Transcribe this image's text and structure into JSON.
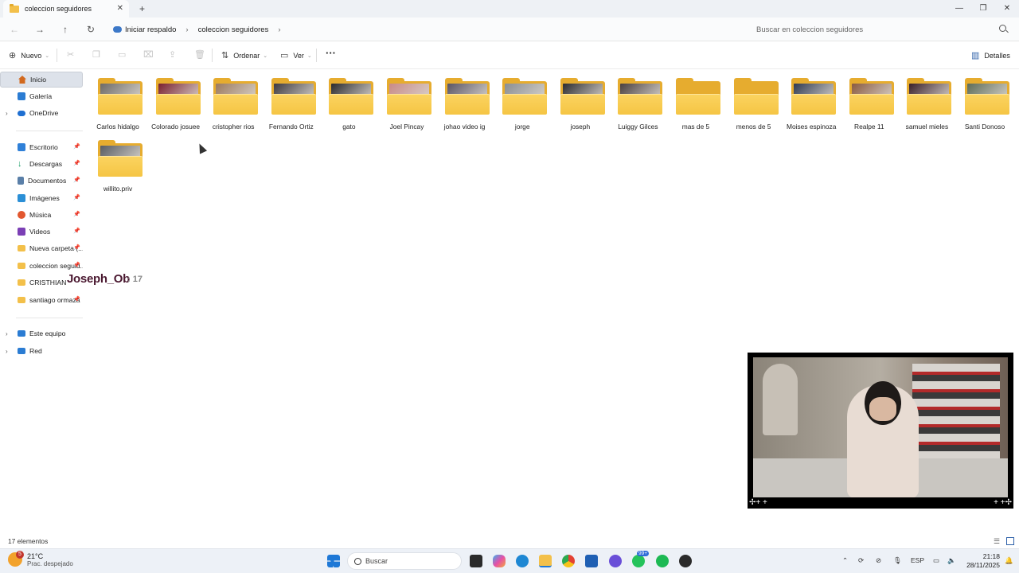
{
  "window": {
    "tab_title": "coleccion seguidores",
    "new_tab": "+",
    "minimize": "—",
    "maximize": "❐",
    "close": "✕"
  },
  "nav": {
    "back": "←",
    "forward": "→",
    "up": "↑",
    "refresh": "↻",
    "breadcrumb": [
      "Iniciar respaldo",
      "coleccion seguidores"
    ],
    "search_placeholder": "Buscar en coleccion seguidores"
  },
  "commandbar": {
    "new_label": "Nuevo",
    "sort_label": "Ordenar",
    "view_label": "Ver",
    "more": "···",
    "details_label": "Detalles"
  },
  "sidebar": {
    "items": [
      {
        "label": "Inicio",
        "icon": "home-icon",
        "color": "#d2691e"
      },
      {
        "label": "Galería",
        "icon": "gallery-icon",
        "color": "#2b7cd3"
      },
      {
        "label": "OneDrive",
        "icon": "cloud-icon",
        "color": "#1f6fd1"
      },
      {
        "label": "Escritorio",
        "icon": "desktop-icon",
        "color": "#2f80d8"
      },
      {
        "label": "Descargas",
        "icon": "download-icon",
        "color": "#1e9f6a"
      },
      {
        "label": "Documentos",
        "icon": "documents-icon",
        "color": "#5a7fa8"
      },
      {
        "label": "Imágenes",
        "icon": "pictures-icon",
        "color": "#2b8fd6"
      },
      {
        "label": "Música",
        "icon": "music-icon",
        "color": "#e2572f"
      },
      {
        "label": "Videos",
        "icon": "videos-icon",
        "color": "#7b3fb5"
      },
      {
        "label": "Nueva carpeta (...",
        "icon": "folder-icon",
        "color": "#f3c04a"
      },
      {
        "label": "coleccion seguid...",
        "icon": "folder-icon",
        "color": "#f3c04a"
      },
      {
        "label": "CRISTHIAN",
        "icon": "folder-icon",
        "color": "#f3c04a"
      },
      {
        "label": "santiago ormaza",
        "icon": "folder-icon",
        "color": "#f3c04a"
      },
      {
        "label": "Este equipo",
        "icon": "computer-icon",
        "color": "#2b7cd3"
      },
      {
        "label": "Red",
        "icon": "network-icon",
        "color": "#2b7cd3"
      }
    ]
  },
  "overlay": {
    "name": "Joseph_Ob",
    "suffix": ": 17"
  },
  "folders": [
    {
      "label": "Carlos hidalgo",
      "thumb": "#6d6a66"
    },
    {
      "label": "Colorado josuee",
      "thumb": "#7a2030"
    },
    {
      "label": "cristopher rios",
      "thumb": "#9c7a5e"
    },
    {
      "label": "Fernando Ortiz",
      "thumb": "#3e3a40"
    },
    {
      "label": "gato",
      "thumb": "#2a2a2e"
    },
    {
      "label": "Joel Pincay",
      "thumb": "#c98a86"
    },
    {
      "label": "johao video ig",
      "thumb": "#5a5565"
    },
    {
      "label": "jorge",
      "thumb": "#8a8e92"
    },
    {
      "label": "joseph",
      "thumb": "#2c2c30"
    },
    {
      "label": "Luiggy Gilces",
      "thumb": "#4a4040"
    },
    {
      "label": "mas de 5",
      "thumb": ""
    },
    {
      "label": "menos de 5",
      "thumb": ""
    },
    {
      "label": "Moises espinoza",
      "thumb": "#2f3a52"
    },
    {
      "label": "Realpe 11",
      "thumb": "#8a5a40"
    },
    {
      "label": "samuel mieles",
      "thumb": "#3a1f2a"
    },
    {
      "label": "Santi Donoso",
      "thumb": "#5e6c58"
    },
    {
      "label": "willito.priv",
      "thumb": "#585c62"
    }
  ],
  "status": {
    "item_count": "17 elementos"
  },
  "webcam": {
    "left_marks": "✢+ +",
    "right_marks": "+ +✢"
  },
  "taskbar": {
    "weather_badge": "5",
    "temperature": "21°C",
    "condition": "Prac. despejado",
    "search_label": "Buscar",
    "language": "ESP",
    "time": "21:18",
    "date": "28/11/2025",
    "whatsapp_badge": "99+"
  }
}
